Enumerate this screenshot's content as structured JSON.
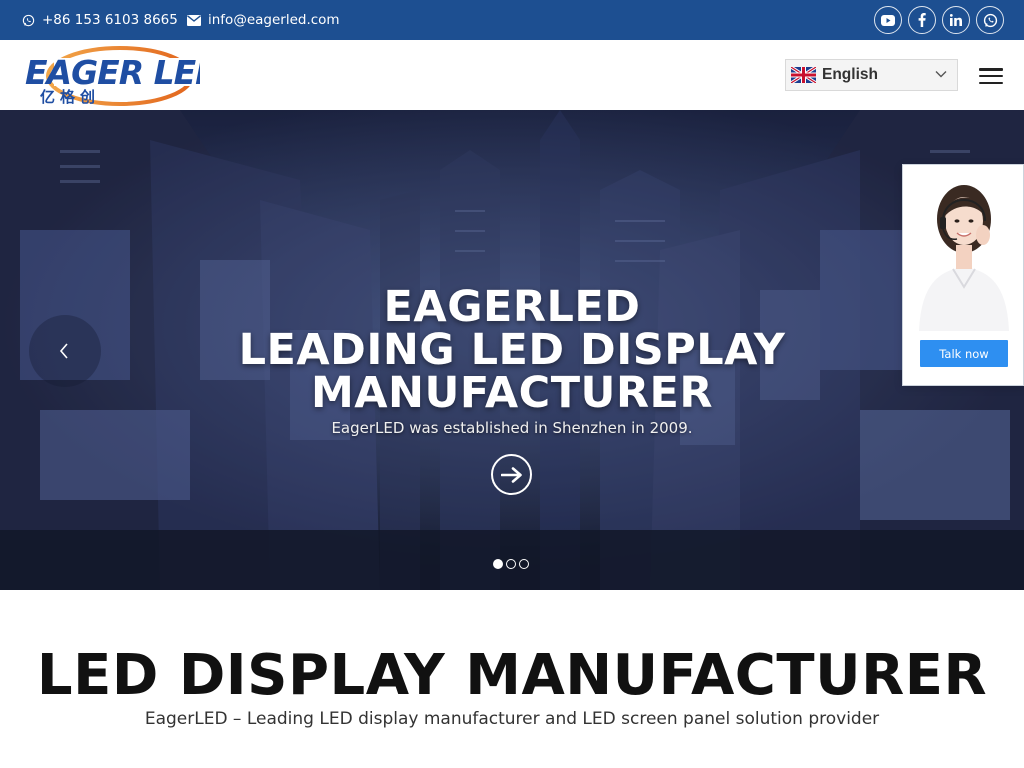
{
  "topbar": {
    "phone": "+86 153 6103 8665",
    "email": "info@eagerled.com",
    "phone_icon": "whatsapp-icon",
    "email_icon": "mail-icon",
    "socials": [
      "youtube-icon",
      "facebook-icon",
      "linkedin-icon",
      "whatsapp-icon"
    ]
  },
  "header": {
    "logo_text": "EAGER LED",
    "logo_cn": "亿格创",
    "language": "English",
    "language_flag": "uk-flag-icon",
    "menu_icon": "hamburger-icon"
  },
  "hero": {
    "title_line1": "EAGERLED",
    "title_line2": "LEADING LED DISPLAY",
    "title_line3": "MANUFACTURER",
    "subtitle": "EagerLED was established in Shenzhen in 2009.",
    "slides_total": 3,
    "active_slide": 1
  },
  "chat": {
    "button": "Talk now"
  },
  "intro": {
    "title": "LED DISPLAY MANUFACTURER",
    "subtitle": "EagerLED – Leading LED display manufacturer and LED screen panel solution provider"
  },
  "colors": {
    "topbar": "#1d4f91",
    "brand_blue": "#1f4ea3",
    "brand_orange": "#e8772a",
    "chat_button": "#2e8ff1"
  }
}
